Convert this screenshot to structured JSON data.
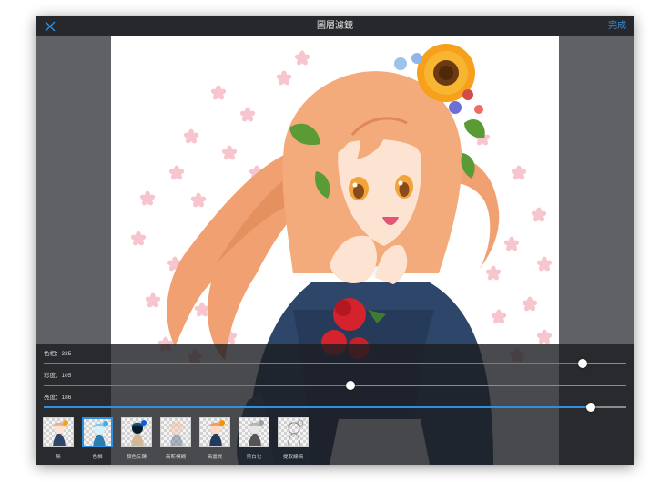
{
  "topbar": {
    "title": "圖層濾鏡",
    "done_label": "完成",
    "close_icon": "close-x-icon"
  },
  "colors": {
    "accent": "#2f8fe0",
    "toolbar": "#27282b",
    "workspace": "#5f6165",
    "panel": "#1c1d20"
  },
  "sliders": [
    {
      "id": "hue",
      "label": "色相：335",
      "fraction": 0.925
    },
    {
      "id": "saturation",
      "label": "彩度：105",
      "fraction": 0.527
    },
    {
      "id": "brightness",
      "label": "亮度：186",
      "fraction": 0.939
    }
  ],
  "presets": [
    {
      "id": "none",
      "label": "無",
      "selected": false
    },
    {
      "id": "hue",
      "label": "色相",
      "selected": true
    },
    {
      "id": "invert",
      "label": "顏色反轉",
      "selected": false
    },
    {
      "id": "gaussian-blur",
      "label": "高斯模糊",
      "selected": false
    },
    {
      "id": "sharpen",
      "label": "高畫質",
      "selected": false
    },
    {
      "id": "grayscale",
      "label": "黑白化",
      "selected": false
    },
    {
      "id": "line-extract",
      "label": "提取線稿",
      "selected": false
    }
  ]
}
